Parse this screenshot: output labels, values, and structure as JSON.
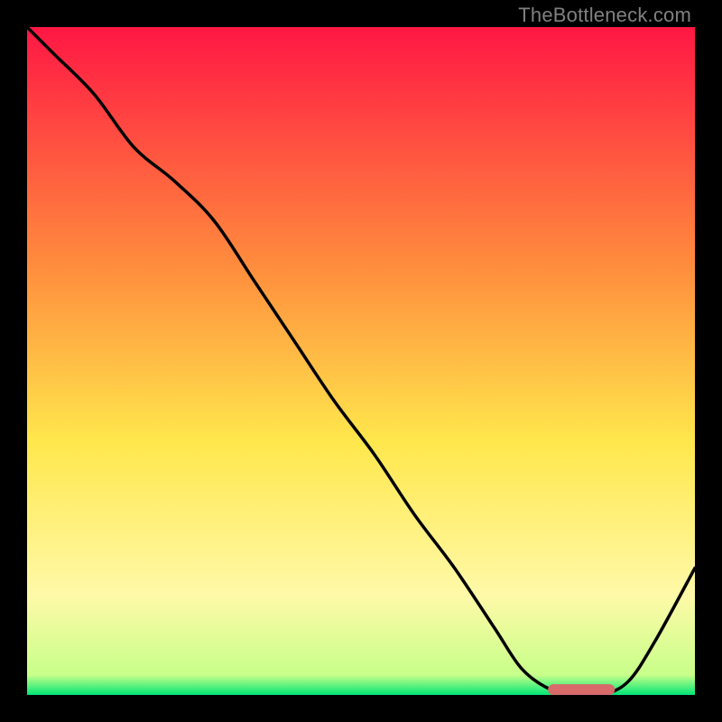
{
  "watermark": "TheBottleneck.com",
  "colors": {
    "bg": "#000000",
    "line": "#000000",
    "marker": "#d86a6a",
    "grad_top": "#ff1744",
    "grad_mid1": "#ff8a3d",
    "grad_mid2": "#ffe74c",
    "grad_low": "#fff9a8",
    "grad_bottom": "#00e676"
  },
  "chart_data": {
    "type": "line",
    "title": "",
    "xlabel": "",
    "ylabel": "",
    "xlim": [
      0,
      100
    ],
    "ylim": [
      0,
      100
    ],
    "x": [
      0,
      4,
      10,
      16,
      22,
      28,
      34,
      40,
      46,
      52,
      58,
      64,
      70,
      74,
      78,
      82,
      86,
      90,
      94,
      100
    ],
    "y": [
      100,
      96,
      90,
      82,
      77,
      71,
      62,
      53,
      44,
      36,
      27,
      19,
      10,
      4,
      1,
      0,
      0,
      2,
      8,
      19
    ],
    "marker": {
      "x_start": 78,
      "x_end": 88,
      "y": 0.8
    }
  }
}
